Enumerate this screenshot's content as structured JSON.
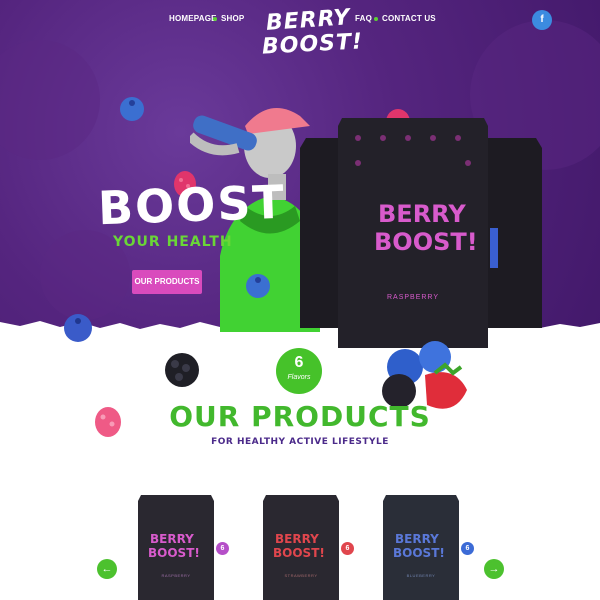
{
  "nav": {
    "items": [
      "HOMEPAGE",
      "SHOP",
      "FAQ",
      "CONTACT US"
    ],
    "facebook_label": "f"
  },
  "logo": {
    "line1": "BERRY",
    "line2": "BOOST!"
  },
  "hero": {
    "title": "BOOST",
    "subtitle": "YOUR HEALTH",
    "button_label": "OUR PRODUCTS",
    "pouch_brand_line1": "BERRY",
    "pouch_brand_line2": "BOOST!",
    "pouch_flavor": "RASPBERRY"
  },
  "flavors_badge": {
    "number": "6",
    "label": "Flavors"
  },
  "products_section": {
    "title": "OUR PRODUCTS",
    "subtitle": "FOR HEALTHY ACTIVE LIFESTYLE",
    "prev_label": "←",
    "next_label": "→",
    "items": [
      {
        "brand1": "BERRY",
        "brand2": "BOOST!",
        "flavor": "RASPBERRY",
        "badge": "6"
      },
      {
        "brand1": "BERRY",
        "brand2": "BOOST!",
        "flavor": "STRAWBERRY",
        "badge": "6"
      },
      {
        "brand1": "BERRY",
        "brand2": "BOOST!",
        "flavor": "BLUEBERRY",
        "badge": "6"
      }
    ]
  },
  "colors": {
    "purple": "#55257f",
    "green": "#46c22a",
    "pink": "#d94bbd",
    "blue_fb": "#3c8be0"
  }
}
